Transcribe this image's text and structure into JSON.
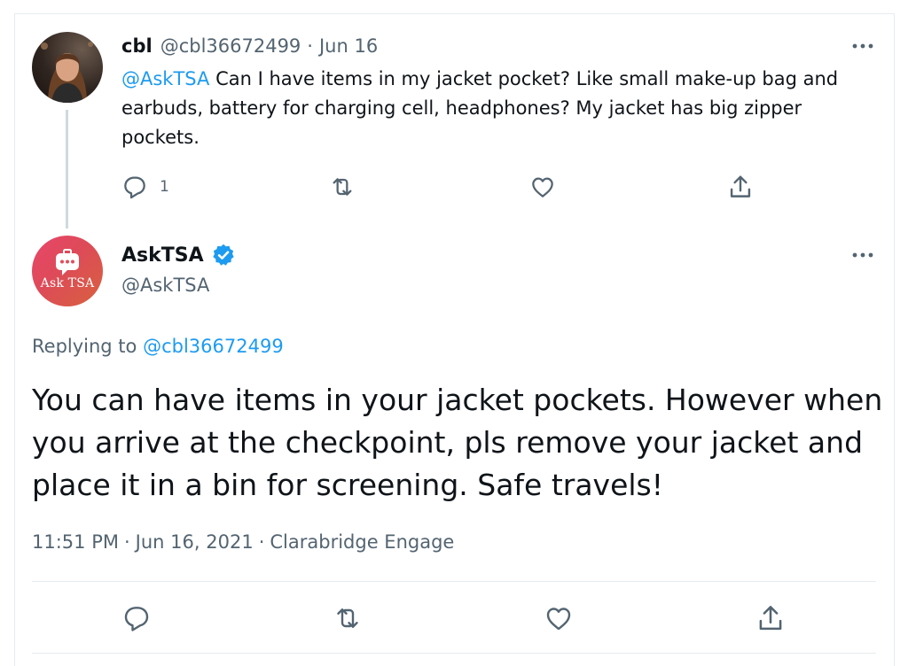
{
  "reply_to_tweet": {
    "author_name": "cbl",
    "author_handle": "@cbl36672499",
    "separator": "·",
    "date": "Jun 16",
    "mention": "@AskTSA",
    "text": " Can I have items in my jacket pocket? Like small make-up bag and earbuds, battery for charging cell, headphones? My jacket has big zipper pockets.",
    "reply_count": "1",
    "more_icon": "more-horizontal-icon",
    "actions": [
      "reply-icon",
      "retweet-icon",
      "like-icon",
      "share-icon"
    ]
  },
  "main_tweet": {
    "author_name": "AskTSA",
    "author_handle": "@AskTSA",
    "avatar_text": "Ask TSA",
    "verified_icon": "verified-badge-icon",
    "replying_prefix": "Replying to ",
    "replying_handle": "@cbl36672499",
    "text": "You can have items in your jacket pockets. However when you arrive at the checkpoint, pls remove your jacket and place it in a bin for screening. Safe travels!",
    "time": "11:51 PM",
    "separator": "·",
    "date": "Jun 16, 2021",
    "source": "Clarabridge Engage",
    "more_icon": "more-horizontal-icon",
    "actions": [
      "reply-icon",
      "retweet-icon",
      "like-icon",
      "share-icon"
    ]
  },
  "colors": {
    "text": "#0f1419",
    "secondary": "#536471",
    "link": "#1d9bf0",
    "thread_line": "#cfd9de",
    "border": "#e6ecf0",
    "askTSA_gradient_start": "#e9456a",
    "askTSA_gradient_end": "#d8613e"
  }
}
